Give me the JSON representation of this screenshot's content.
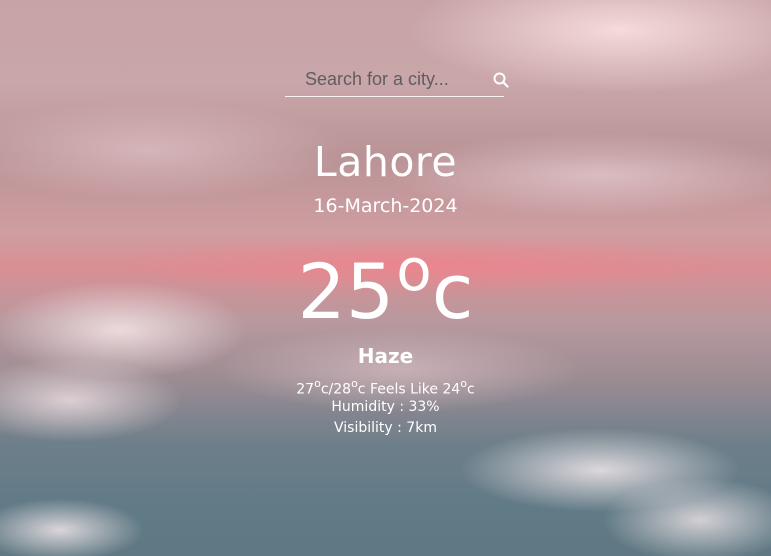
{
  "search": {
    "placeholder": "Search for a city...",
    "icon": "search-icon"
  },
  "weather": {
    "city": "Lahore",
    "date": "16-March-2024",
    "temp": "25",
    "temp_unit_sup": "o",
    "temp_unit": "c",
    "condition": "Haze",
    "min": "27",
    "max": "28",
    "feels_like_label": "Feels Like",
    "feels_like": "24",
    "unit_sup": "o",
    "unit": "c",
    "separator": "/",
    "humidity": "Humidity : 33%",
    "visibility": "Visibility : 7km"
  }
}
